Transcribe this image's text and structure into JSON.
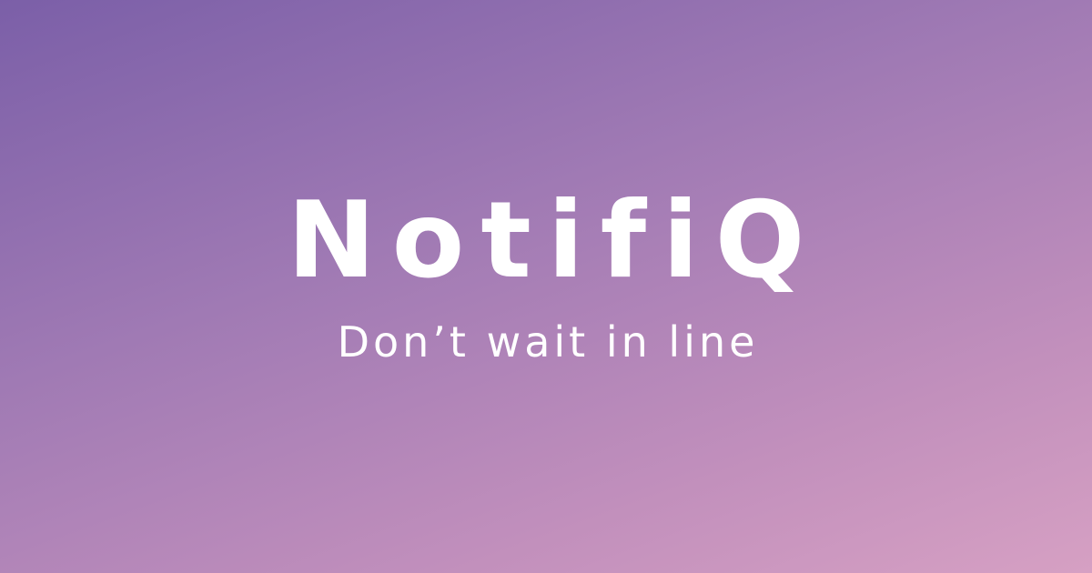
{
  "brand": {
    "name": "NotifiQ",
    "tagline": "Don’t wait in line"
  },
  "colors": {
    "gradient_start": "#7b5fa8",
    "gradient_end": "#d6a0c3",
    "text": "#ffffff"
  }
}
